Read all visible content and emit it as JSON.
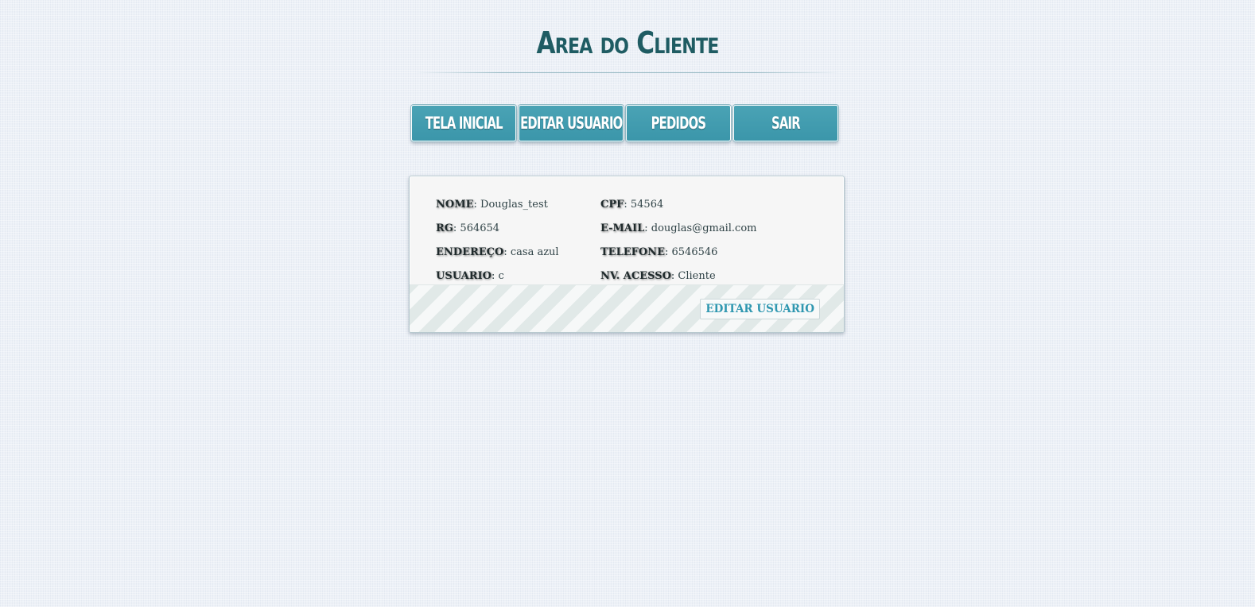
{
  "header": {
    "title": "Area do Cliente"
  },
  "nav": {
    "items": [
      {
        "label": "TELA INICIAL"
      },
      {
        "label": "EDITAR USUARIO"
      },
      {
        "label": "PEDIDOS"
      },
      {
        "label": "SAIR"
      }
    ]
  },
  "profile": {
    "nome_label": "NOME",
    "nome_value": "Douglas_test",
    "cpf_label": "CPF",
    "cpf_value": "54564",
    "rg_label": "RG",
    "rg_value": "564654",
    "email_label": "E-MAIL",
    "email_value": "douglas@gmail.com",
    "endereco_label": "ENDEREÇO",
    "endereco_value": "casa azul",
    "telefone_label": "TELEFONE",
    "telefone_value": "6546546",
    "usuario_label": "USUARIO",
    "usuario_value": "c",
    "nivel_label": "NV. ACESSO",
    "nivel_value": "Cliente",
    "separator": ": "
  },
  "footer": {
    "edit_label": "EDITAR USUARIO"
  },
  "colors": {
    "accent": "#3b96aa",
    "title": "#1f5c63",
    "link": "#2f97b0"
  }
}
